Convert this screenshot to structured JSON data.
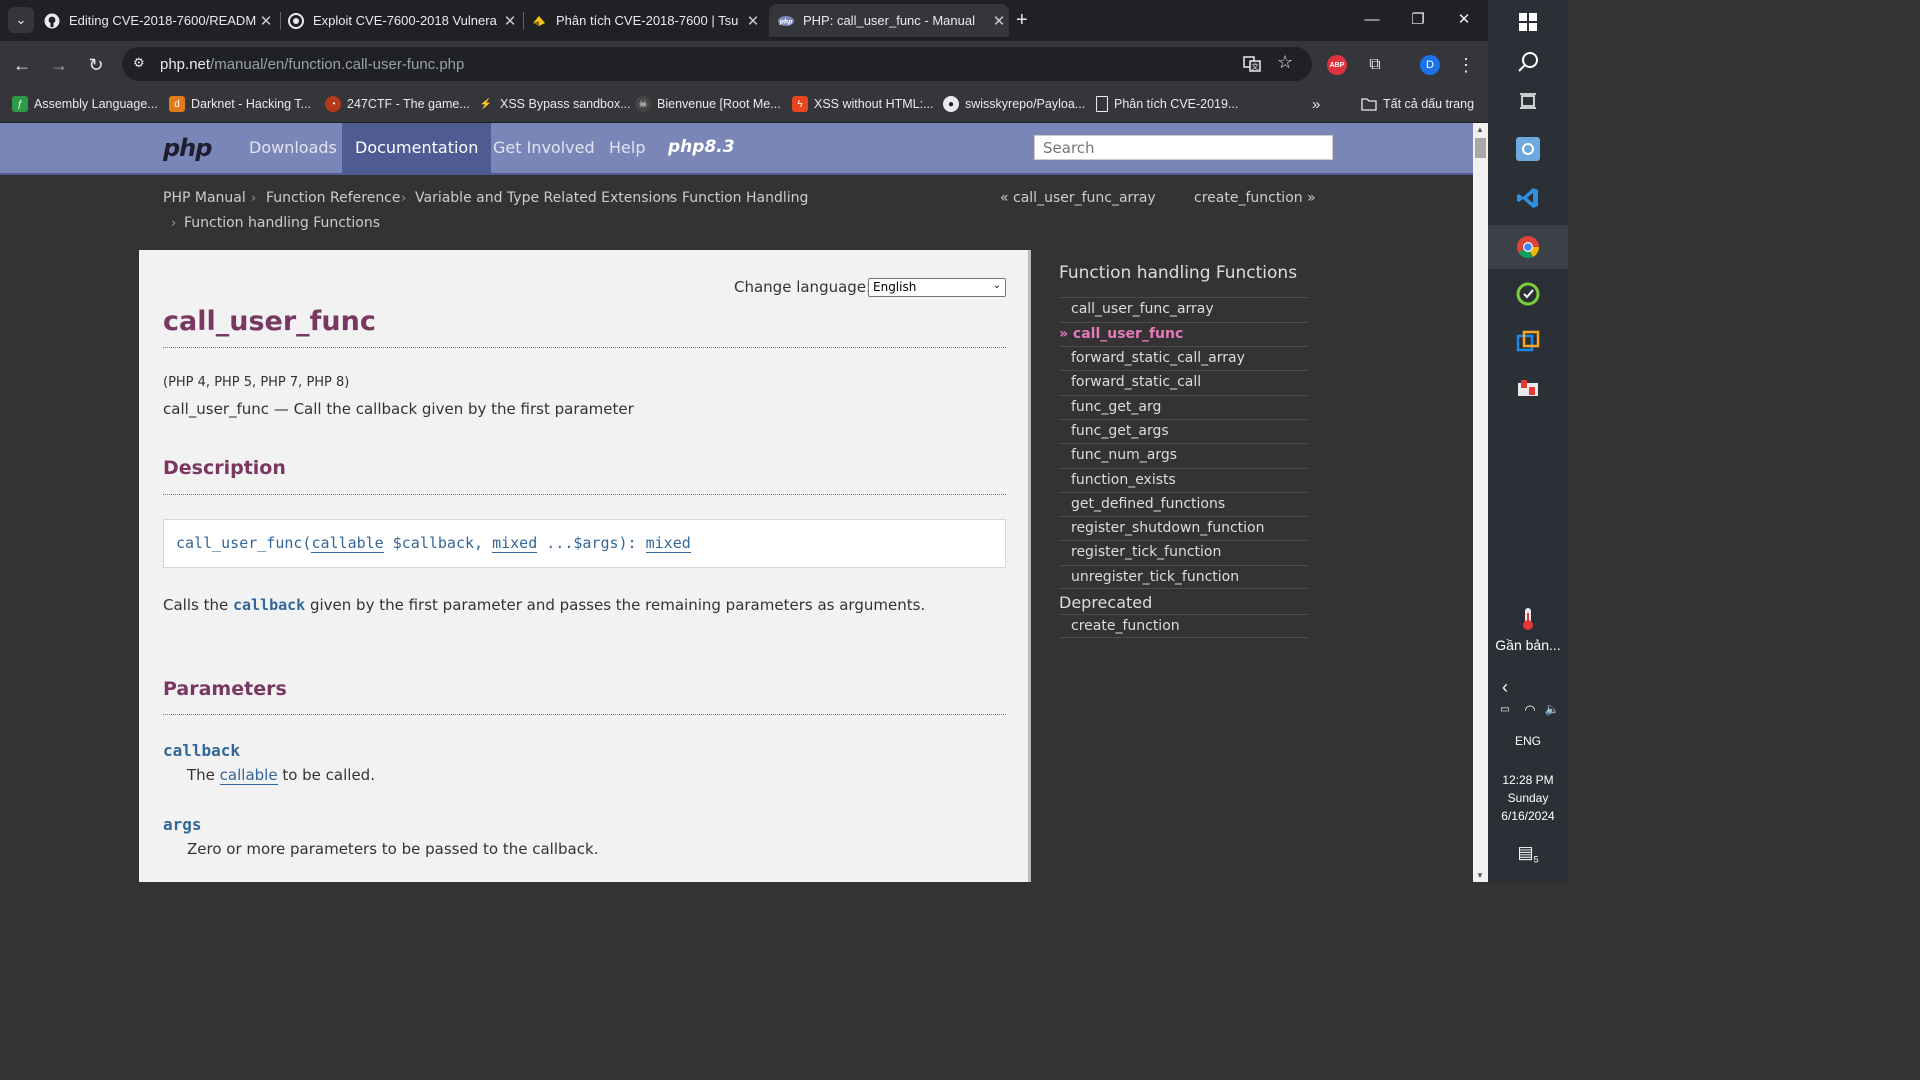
{
  "tabs": [
    {
      "title": "Editing CVE-2018-7600/READM",
      "icon": "github-icon",
      "active": false
    },
    {
      "title": "Exploit CVE-7600-2018 Vulnera",
      "icon": "site-icon",
      "active": false
    },
    {
      "title": "Phân tích CVE-2018-7600 | Tsu",
      "icon": "site-icon",
      "active": false
    },
    {
      "title": "PHP: call_user_func - Manual",
      "icon": "php-icon",
      "active": true
    }
  ],
  "address": {
    "host": "php.net",
    "path": "/manual/en/function.call-user-func.php"
  },
  "profile_initial": "D",
  "abp_label": "ABP",
  "bookmarks": [
    "Assembly Language...",
    "Darknet - Hacking T...",
    "247CTF - The game...",
    "XSS Bypass sandbox...",
    "Bienvenue [Root Me...",
    "XSS without HTML:...",
    "swisskyrepo/Payloa...",
    "Phân tích CVE-2019...",
    "Tất cả dấu trang"
  ],
  "php_nav": {
    "logo": "php",
    "items": [
      "Downloads",
      "Documentation",
      "Get Involved",
      "Help"
    ],
    "current": "Documentation",
    "version_badge": "php8.3",
    "search_placeholder": "Search"
  },
  "breadcrumb": [
    "PHP Manual",
    "Function Reference",
    "Variable and Type Related Extensions",
    "Function Handling",
    "Function handling Functions"
  ],
  "prev_link": "« call_user_func_array",
  "next_link": "create_function »",
  "change_language": {
    "label": "Change language:",
    "selected": "English"
  },
  "refname": "call_user_func",
  "versions": "(PHP 4, PHP 5, PHP 7, PHP 8)",
  "refpurpose": "call_user_func — Call the callback given by the first parameter",
  "description_heading": "Description",
  "synopsis": {
    "name": "call_user_func(",
    "type1": "callable",
    "param1": " $callback, ",
    "type2": "mixed",
    "param2": " ...$args): ",
    "return_type": "mixed"
  },
  "description_text": {
    "before": "Calls the ",
    "code": "callback",
    "after": " given by the first parameter and passes the remaining parameters as arguments."
  },
  "parameters_heading": "Parameters",
  "parameters": [
    {
      "name": "callback",
      "text_before": "The ",
      "link": "callable",
      "text_after": " to be called."
    },
    {
      "name": "args",
      "text": "Zero or more parameters to be passed to the callback."
    }
  ],
  "sidebar": {
    "title": "Function handling Functions",
    "items": [
      "call_user_func_array",
      "» call_user_func",
      "forward_static_call_array",
      "forward_static_call",
      "func_get_arg",
      "func_get_args",
      "func_num_args",
      "function_exists",
      "get_defined_functions",
      "register_shutdown_function",
      "register_tick_function",
      "unregister_tick_function"
    ],
    "current_index": 1,
    "deprecated_heading": "Deprecated",
    "deprecated_items": [
      "create_function"
    ]
  },
  "taskbar": {
    "weather_text": "Gần bản...",
    "language": "ENG",
    "time": "12:28 PM",
    "day": "Sunday",
    "date": "6/16/2024",
    "notification_count": "5"
  }
}
